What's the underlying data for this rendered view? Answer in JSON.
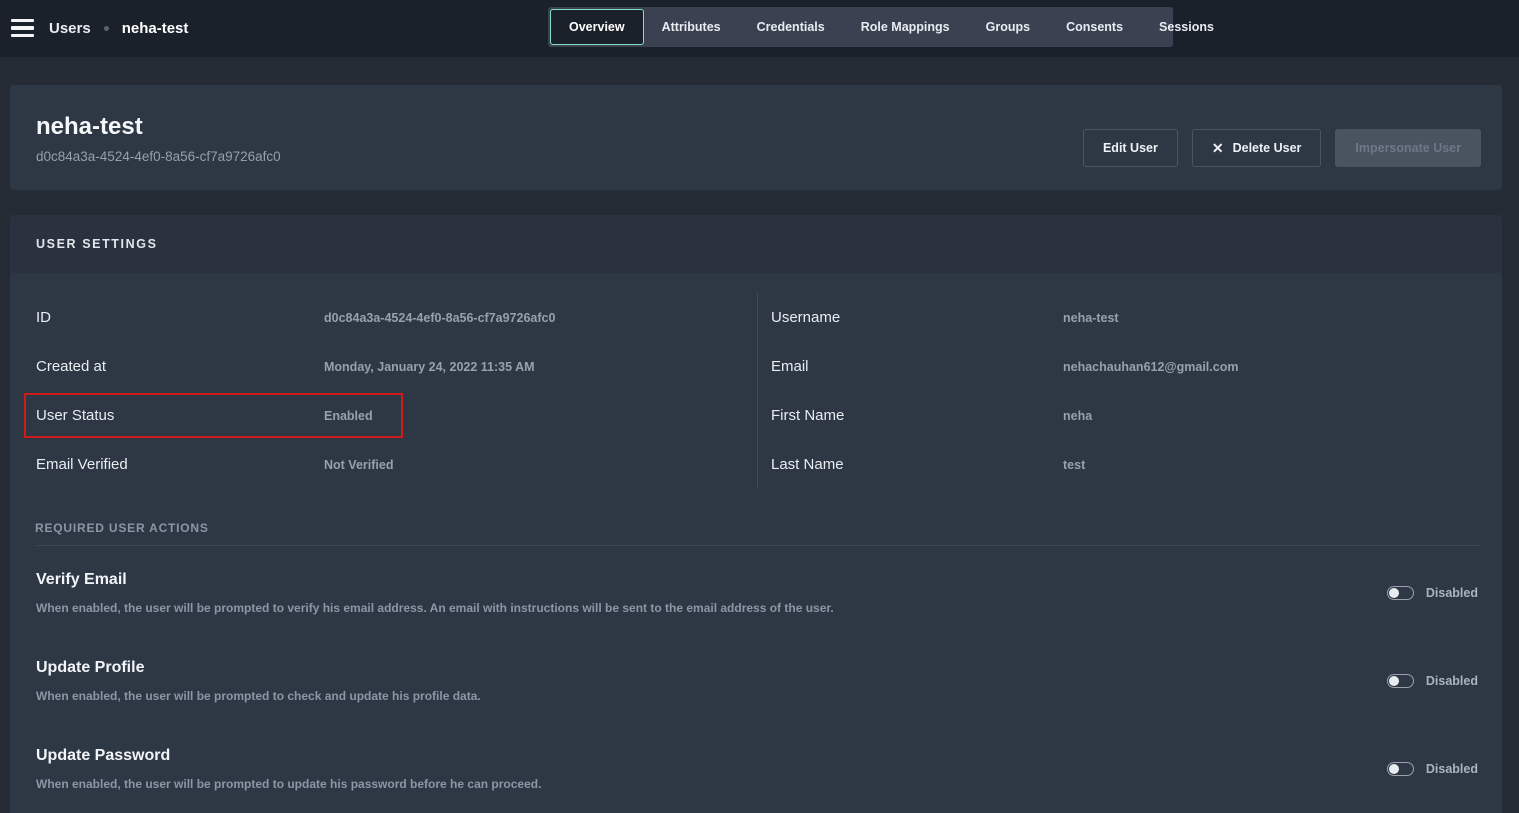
{
  "topbar": {
    "breadcrumb": {
      "root": "Users",
      "current": "neha-test"
    },
    "tabs": [
      {
        "label": "Overview"
      },
      {
        "label": "Attributes"
      },
      {
        "label": "Credentials"
      },
      {
        "label": "Role Mappings"
      },
      {
        "label": "Groups"
      },
      {
        "label": "Consents"
      },
      {
        "label": "Sessions"
      }
    ],
    "active_tab": "Overview"
  },
  "header": {
    "title": "neha-test",
    "user_id": "d0c84a3a-4524-4ef0-8a56-cf7a9726afc0",
    "edit_label": "Edit User",
    "delete_icon": "✕",
    "delete_label": "Delete User",
    "impersonate_label": "Impersonate User"
  },
  "user_settings": {
    "section_title": "USER SETTINGS",
    "left_fields": [
      {
        "label": "ID",
        "value": "d0c84a3a-4524-4ef0-8a56-cf7a9726afc0"
      },
      {
        "label": "Created at",
        "value": "Monday, January 24, 2022 11:35 AM"
      },
      {
        "label": "User Status",
        "value": "Enabled",
        "highlighted": true
      },
      {
        "label": "Email Verified",
        "value": "Not Verified"
      }
    ],
    "right_fields": [
      {
        "label": "Username",
        "value": "neha-test"
      },
      {
        "label": "Email",
        "value": "nehachauhan612@gmail.com"
      },
      {
        "label": "First Name",
        "value": "neha"
      },
      {
        "label": "Last Name",
        "value": "test"
      }
    ]
  },
  "required_actions": {
    "section_title": "REQUIRED USER ACTIONS",
    "items": [
      {
        "title": "Verify Email",
        "description": "When enabled, the user will be prompted to verify his email address. An email with instructions will be sent to the email address of the user.",
        "state": "Disabled"
      },
      {
        "title": "Update Profile",
        "description": "When enabled, the user will be prompted to check and update his profile data.",
        "state": "Disabled"
      },
      {
        "title": "Update Password",
        "description": "When enabled, the user will be prompted to update his password before he can proceed.",
        "state": "Disabled"
      }
    ]
  },
  "colors": {
    "topbar_bg": "#1b212b",
    "page_bg": "#252b35",
    "card_bg": "#2e3744",
    "section_band_bg": "#2a323f",
    "tabstrip_bg": "#3a4252",
    "active_tab_bg": "#1a212b",
    "accent_teal": "#7fe0c2",
    "highlight_red": "#d01b1b"
  }
}
